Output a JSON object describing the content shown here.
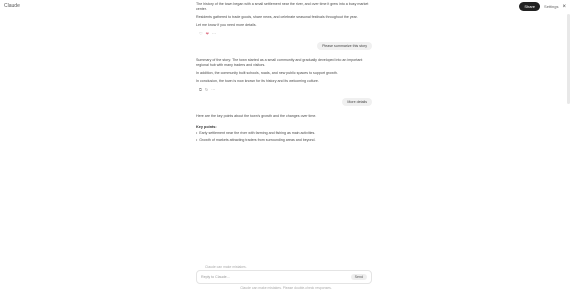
{
  "app": {
    "title": "Claude"
  },
  "top_right": {
    "pill": "Share",
    "menu": "Settings",
    "close": "×"
  },
  "messages": [
    {
      "type": "assistant",
      "paragraphs": [
        "The history of the town began with a small settlement near the river, and over time it grew into a busy market center.",
        "Residents gathered to trade goods, share news, and celebrate seasonal festivals throughout the year.",
        "Let me know if you need more details."
      ]
    },
    {
      "type": "reactions",
      "items": [
        "♡",
        "❤",
        "⋯"
      ]
    },
    {
      "type": "user",
      "text": "Please summarize this story"
    },
    {
      "type": "assistant",
      "paragraphs": [
        "Summary of the story: The town started as a small community and gradually developed into an important regional hub with many traders and visitors.",
        "In addition, the community built schools, roads, and new public spaces to support growth.",
        "In conclusion, the town is now known for its history and its welcoming culture."
      ]
    },
    {
      "type": "reactions",
      "items": [
        "⧉",
        "↻",
        "⋯"
      ]
    },
    {
      "type": "user",
      "text": "More details"
    },
    {
      "type": "assistant",
      "paragraphs": [
        "Here are the key points about the town's growth and the changes over time."
      ]
    }
  ],
  "list": {
    "title": "Key points:",
    "bullets": [
      "Early settlement near the river with farming and fishing as main activities.",
      "Growth of markets attracting traders from surrounding areas and beyond."
    ]
  },
  "composer": {
    "placeholder": "Reply to Claude...",
    "hint": "Claude can make mistakes.",
    "send": "Send"
  },
  "footer": {
    "text": "Claude can make mistakes. Please double-check responses."
  }
}
